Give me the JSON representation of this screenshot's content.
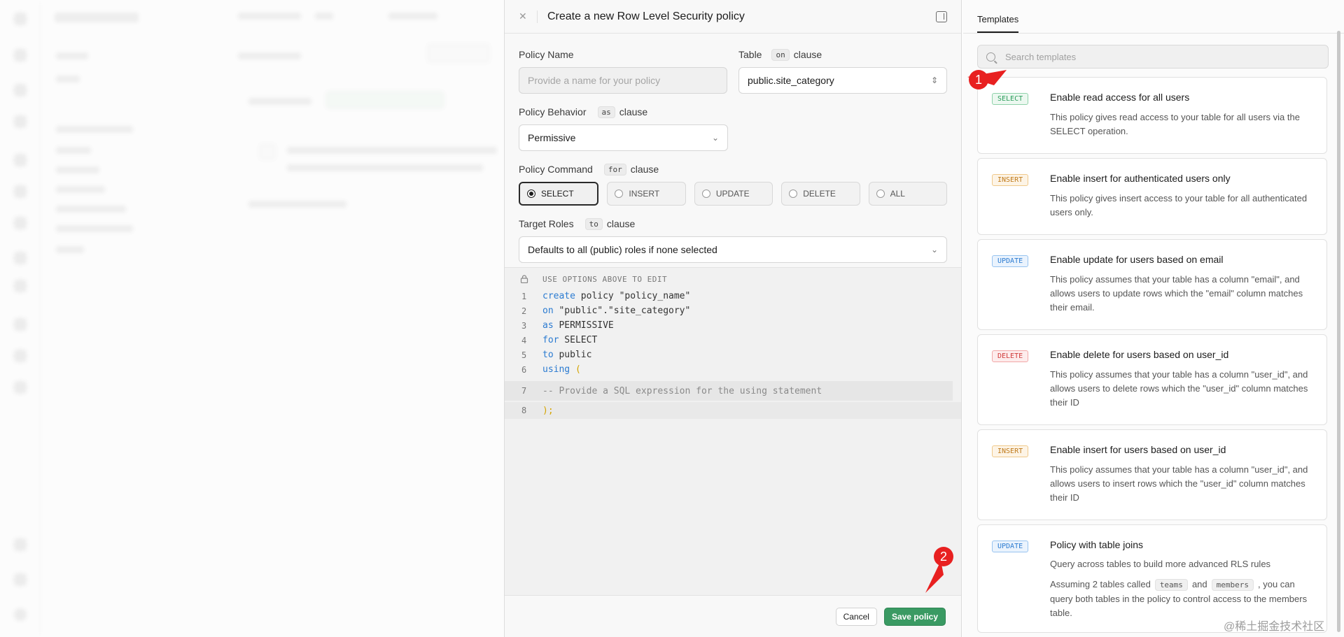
{
  "editor": {
    "title": "Create a new Row Level Security policy",
    "policy_name": {
      "label": "Policy Name",
      "placeholder": "Provide a name for your policy"
    },
    "table": {
      "label": "Table",
      "keyword": "on",
      "clause": "clause",
      "value": "public.site_category"
    },
    "behavior": {
      "label": "Policy Behavior",
      "keyword": "as",
      "clause": "clause",
      "value": "Permissive"
    },
    "command": {
      "label": "Policy Command",
      "keyword": "for",
      "clause": "clause",
      "options": [
        "SELECT",
        "INSERT",
        "UPDATE",
        "DELETE",
        "ALL"
      ],
      "selected": "SELECT"
    },
    "roles": {
      "label": "Target Roles",
      "keyword": "to",
      "clause": "clause",
      "value": "Defaults to all (public) roles if none selected"
    },
    "code": {
      "hint": "USE OPTIONS ABOVE TO EDIT",
      "lines": [
        {
          "n": "1",
          "kw": "create",
          "rest": " policy \"policy_name\""
        },
        {
          "n": "2",
          "kw": "on",
          "rest": " \"public\".\"site_category\""
        },
        {
          "n": "3",
          "kw": "as",
          "rest": " PERMISSIVE"
        },
        {
          "n": "4",
          "kw": "for",
          "rest": " SELECT"
        },
        {
          "n": "5",
          "kw": "to",
          "rest": " public"
        },
        {
          "n": "6",
          "kw": "using",
          "rest": " ("
        },
        {
          "n": "7",
          "comment": "-- Provide a SQL expression for the using statement"
        },
        {
          "n": "8",
          "close": ");"
        }
      ]
    },
    "footer": {
      "cancel": "Cancel",
      "save": "Save policy"
    }
  },
  "templates": {
    "tab": "Templates",
    "search_placeholder": "Search templates",
    "cards": [
      {
        "badge": "SELECT",
        "title": "Enable read access for all users",
        "desc": "This policy gives read access to your table for all users via the SELECT operation."
      },
      {
        "badge": "INSERT",
        "title": "Enable insert for authenticated users only",
        "desc": "This policy gives insert access to your table for all authenticated users only."
      },
      {
        "badge": "UPDATE",
        "title": "Enable update for users based on email",
        "desc": "This policy assumes that your table has a column \"email\", and allows users to update rows which the \"email\" column matches their email."
      },
      {
        "badge": "DELETE",
        "title": "Enable delete for users based on user_id",
        "desc": "This policy assumes that your table has a column \"user_id\", and allows users to delete rows which the \"user_id\" column matches their ID"
      },
      {
        "badge": "INSERT",
        "title": "Enable insert for users based on user_id",
        "desc": "This policy assumes that your table has a column \"user_id\", and allows users to insert rows which the \"user_id\" column matches their ID"
      },
      {
        "badge": "UPDATE",
        "title": "Policy with table joins",
        "desc": "Query across tables to build more advanced RLS rules",
        "desc2_a": "Assuming 2 tables called",
        "pill1": "teams",
        "desc2_b": "and",
        "pill2": "members",
        "desc2_c": ", you can query both tables in the policy to control access to the members table."
      }
    ]
  },
  "annotations": {
    "marker1": "1",
    "marker2": "2",
    "annotation_color": "#e82020"
  },
  "watermark": "@稀土掘金技术社区",
  "colors": {
    "select": "#2a9c5a",
    "insert": "#c07a1a",
    "update": "#2b7bd1",
    "delete": "#d13b3b",
    "save_button": "#3a9a63"
  }
}
